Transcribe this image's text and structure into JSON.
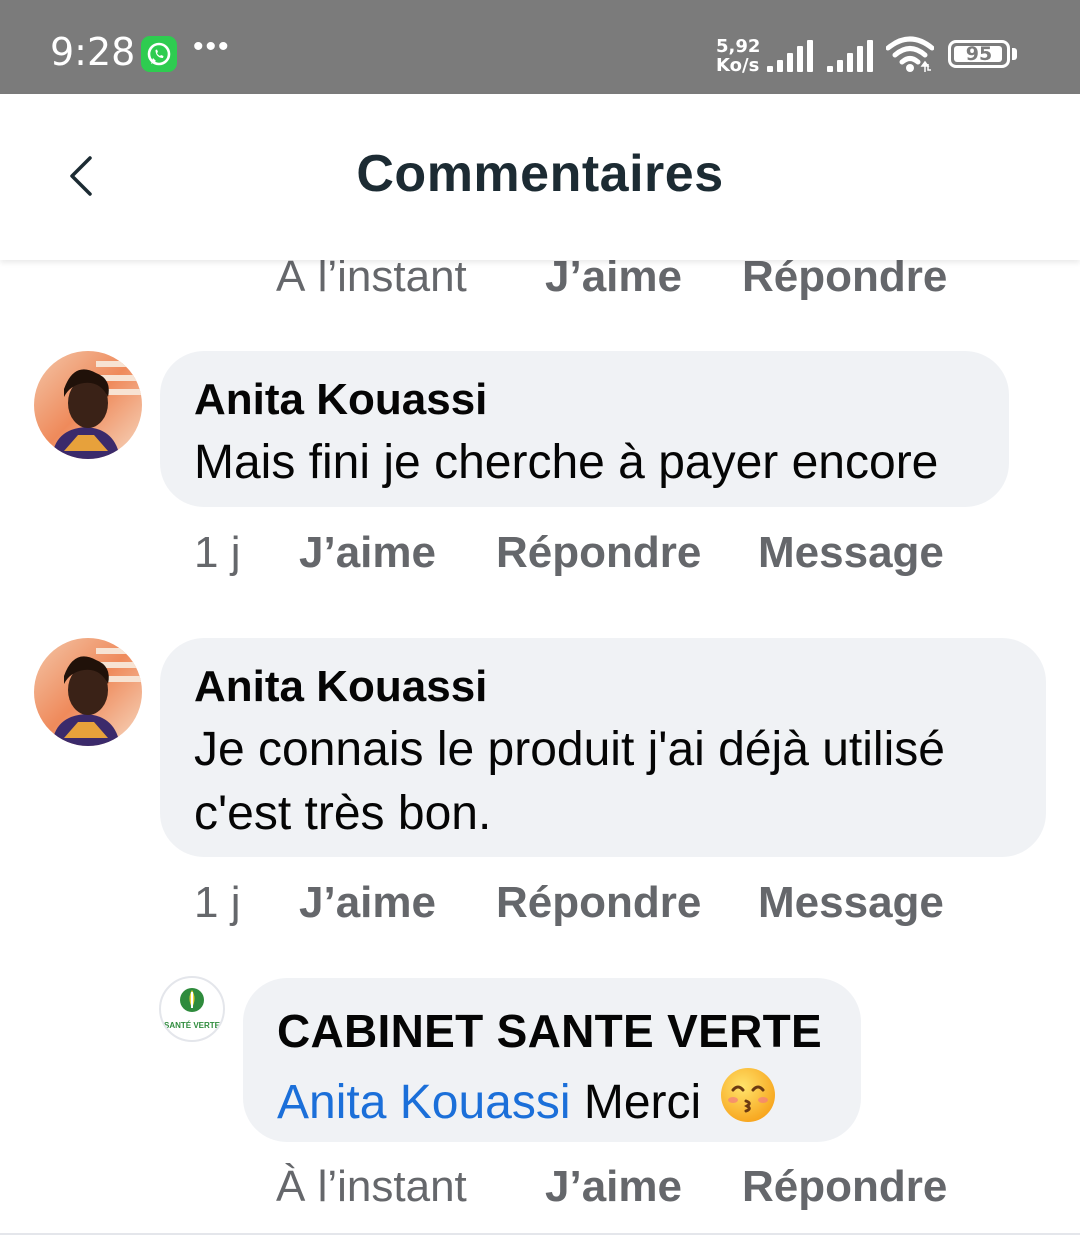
{
  "status_bar": {
    "time": "9:28",
    "network_speed_value": "5,92",
    "network_speed_unit": "Ko/s",
    "battery_level": "95",
    "icons": [
      "whatsapp-icon",
      "more-dots-icon",
      "signal-icon",
      "signal-icon",
      "wifi-icon",
      "battery-icon"
    ]
  },
  "header": {
    "title": "Commentaires",
    "back_icon": "chevron-left-icon"
  },
  "top_actions": {
    "time": "À l’instant",
    "like": "J’aime",
    "reply": "Répondre"
  },
  "comments": [
    {
      "author": "Anita Kouassi",
      "text": "Mais fini je cherche à payer encore",
      "time": "1 j",
      "like": "J’aime",
      "reply": "Répondre",
      "message": "Message"
    },
    {
      "author": "Anita Kouassi",
      "text_line1": "Je connais le produit j'ai déjà utilisé",
      "text_line2": "c'est très bon.",
      "time": "1 j",
      "like": "J’aime",
      "reply": "Répondre",
      "message": "Message"
    }
  ],
  "reply": {
    "author": "CABINET SANTE VERTE",
    "logo_text": "SANTÉ VERTE",
    "mention": "Anita Kouassi",
    "text": "Merci",
    "emoji": "😚",
    "time": "À l’instant",
    "like": "J’aime",
    "reply": "Répondre"
  },
  "colors": {
    "status_bar": "#7b7b7b",
    "title": "#1c2b33",
    "bubble": "#f0f2f5",
    "secondary_text": "#65676b",
    "mention": "#1b6fd9",
    "logo_green": "#2e8b3c"
  }
}
